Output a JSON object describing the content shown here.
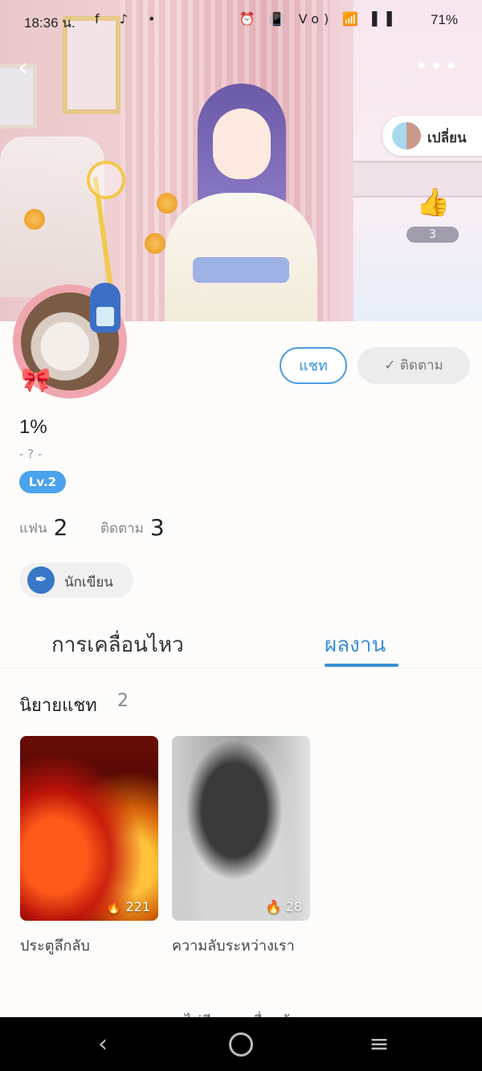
{
  "status_bar": {
    "time": "18:36 น.",
    "left_icons": "f ♪ •",
    "right_icons": "⏰ 📳 Vo) 📶 ▌▌",
    "battery": "71%"
  },
  "cover": {
    "change_label": "เปลี่ยน",
    "like_count": "3"
  },
  "profile": {
    "chat_label": "แชท",
    "follow_label": "✓ ติดตาม",
    "name": "1%",
    "bio": "- ? -",
    "level": "Lv.2",
    "fans_label": "แฟน",
    "fans_count": "2",
    "following_label": "ติดตาม",
    "following_count": "3",
    "role": "นักเขียน"
  },
  "tabs": {
    "activity": "การเคลื่อนไหว",
    "works": "ผลงาน",
    "active": "works"
  },
  "works": {
    "section_title": "นิยายแชท",
    "section_count": "2",
    "items": [
      {
        "title": "ประตูลึกลับ",
        "views": "221"
      },
      {
        "title": "ความลับระหว่างเรา",
        "views": "28"
      }
    ],
    "cut_off_text": "ไม่มีผลงานอื่นแล้ว"
  },
  "colors": {
    "accent": "#3b8fd9",
    "level_badge": "#4aa3ec"
  },
  "icons": [
    "back-icon",
    "more-icon",
    "thumbs-up-icon",
    "pen-icon",
    "flame-icon",
    "nav-back-icon",
    "nav-home-icon",
    "nav-menu-icon"
  ]
}
